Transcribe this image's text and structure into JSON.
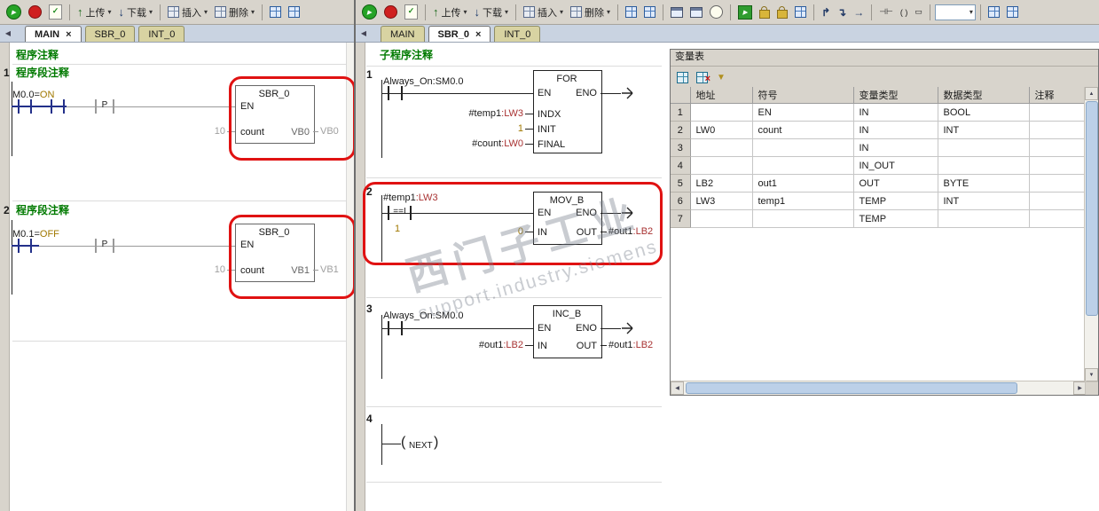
{
  "icons": {
    "play": "▶",
    "check": "✓",
    "chevron_down": "▾",
    "close": "×",
    "tab_prev": "◀",
    "scroll_left": "◀",
    "scroll_right": "▶",
    "scroll_up": "▲",
    "scroll_down": "▼",
    "up_arrow": "↑",
    "down_arrow": "↓",
    "arrow_up_right": "↱",
    "arrow_down_right": "↴",
    "arrow_right": "→",
    "contact_sym": "⊣⊢",
    "coil_sym": "( )",
    "box_sym": "▭",
    "coil_open": "(",
    "coil_close": ")",
    "funnel": "▼"
  },
  "toolbar": {
    "upload": "上传",
    "download": "下载",
    "insert": "插入",
    "delete": "删除"
  },
  "left_window": {
    "tabs": [
      {
        "label": "MAIN",
        "active": true
      },
      {
        "label": "SBR_0",
        "active": false
      },
      {
        "label": "INT_0",
        "active": false
      }
    ],
    "program_comment": "程序注释",
    "net1": {
      "number": "1",
      "title": "程序段注释",
      "contact_label": "M0.0=",
      "contact_state": "ON",
      "edge_label": "P",
      "box_title": "SBR_0",
      "en": "EN",
      "param_in": "count",
      "param_in_value": "10",
      "param_out": "VB0",
      "param_out_value": "VB0"
    },
    "net2": {
      "number": "2",
      "title": "程序段注释",
      "contact_label": "M0.1=",
      "contact_state": "OFF",
      "edge_label": "P",
      "box_title": "SBR_0",
      "en": "EN",
      "param_in": "count",
      "param_in_value": "10",
      "param_out": "VB1",
      "param_out_value": "VB1"
    }
  },
  "mid_window": {
    "tabs": [
      {
        "label": "MAIN",
        "active": false
      },
      {
        "label": "SBR_0",
        "active": true
      },
      {
        "label": "INT_0",
        "active": false
      }
    ],
    "program_comment": "子程序注释",
    "net1": {
      "number": "1",
      "contact_label": "Always_On:SM0.0",
      "box_title": "FOR",
      "en": "EN",
      "eno": "ENO",
      "inputs": [
        {
          "value": "#temp1",
          "addr": ":LW3",
          "label": "INDX"
        },
        {
          "value": "1",
          "addr": "",
          "label": "INIT"
        },
        {
          "value": "#count",
          "addr": ":LW0",
          "label": "FINAL"
        }
      ]
    },
    "net2": {
      "number": "2",
      "cmp_top_value": "#temp1",
      "cmp_top_addr": ":LW3",
      "cmp_op": "==I",
      "cmp_bottom": "1",
      "box_title": "MOV_B",
      "en": "EN",
      "eno": "ENO",
      "in_label": "IN",
      "in_value": "0",
      "out_label": "OUT",
      "out_value": "#out1",
      "out_addr": ":LB2"
    },
    "net3": {
      "number": "3",
      "contact_label": "Always_On:SM0.0",
      "box_title": "INC_B",
      "en": "EN",
      "eno": "ENO",
      "in_label": "IN",
      "in_value": "#out1",
      "in_addr": ":LB2",
      "out_label": "OUT",
      "out_value": "#out1",
      "out_addr": ":LB2"
    },
    "net4": {
      "number": "4",
      "coil_label": "NEXT"
    }
  },
  "var_table": {
    "title": "变量表",
    "columns": [
      "地址",
      "符号",
      "变量类型",
      "数据类型",
      "注释"
    ],
    "rows": [
      {
        "num": "1",
        "addr": "",
        "symbol": "EN",
        "var_type": "IN",
        "data_type": "BOOL",
        "comment": ""
      },
      {
        "num": "2",
        "addr": "LW0",
        "symbol": "count",
        "var_type": "IN",
        "data_type": "INT",
        "comment": ""
      },
      {
        "num": "3",
        "addr": "",
        "symbol": "",
        "var_type": "IN",
        "data_type": "",
        "comment": ""
      },
      {
        "num": "4",
        "addr": "",
        "symbol": "",
        "var_type": "IN_OUT",
        "data_type": "",
        "comment": ""
      },
      {
        "num": "5",
        "addr": "LB2",
        "symbol": "out1",
        "var_type": "OUT",
        "data_type": "BYTE",
        "comment": ""
      },
      {
        "num": "6",
        "addr": "LW3",
        "symbol": "temp1",
        "var_type": "TEMP",
        "data_type": "INT",
        "comment": ""
      },
      {
        "num": "7",
        "addr": "",
        "symbol": "",
        "var_type": "TEMP",
        "data_type": "",
        "comment": ""
      }
    ]
  },
  "watermark": {
    "line1": "西门子工业",
    "line2": "support.industry.siemens"
  }
}
